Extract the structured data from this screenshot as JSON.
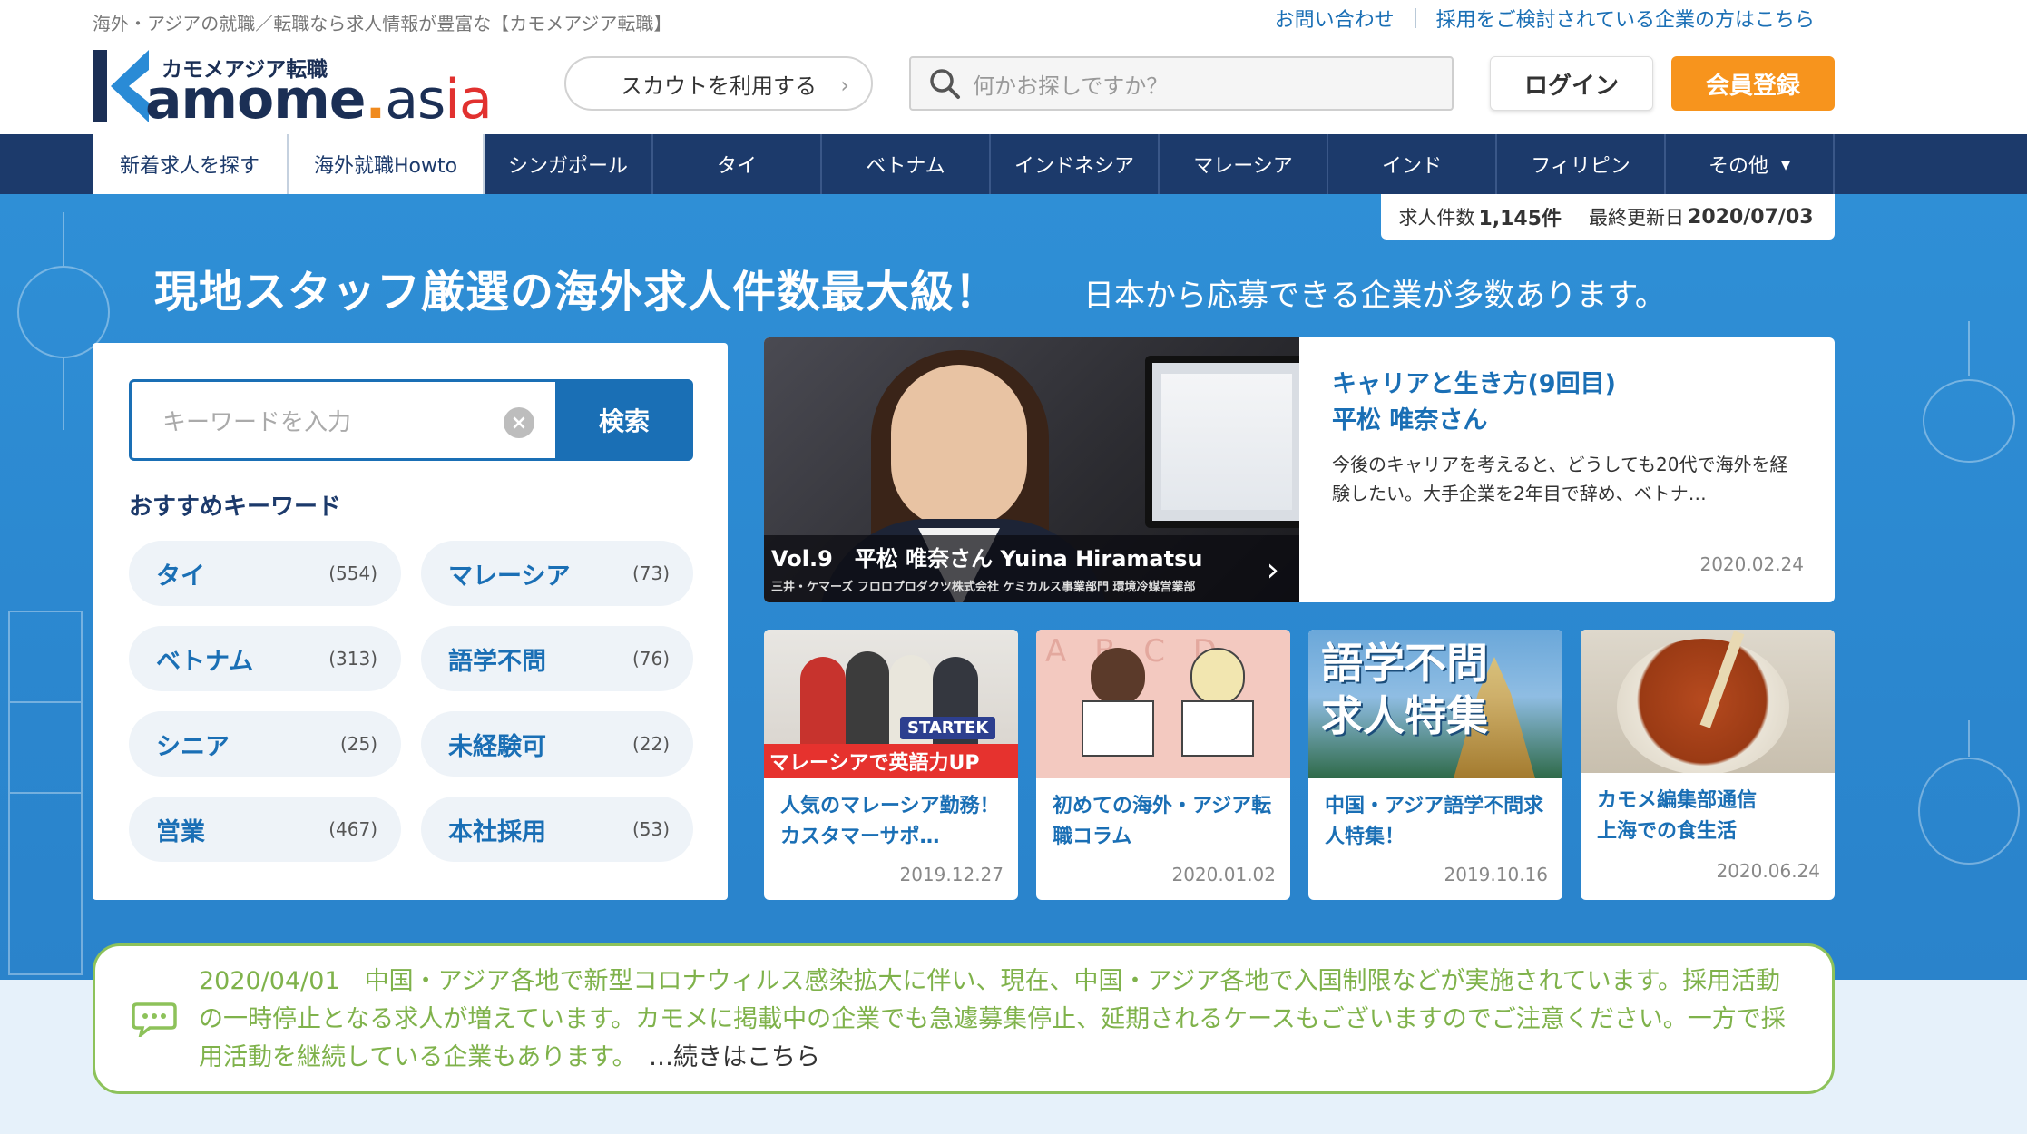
{
  "header": {
    "tagline": "海外・アジアの就職／転職なら求人情報が豊富な【カモメアジア転職】",
    "links": [
      "お問い合わせ",
      "採用をご検討されている企業の方はこちら"
    ],
    "logo_sub": "カモメアジア転職",
    "logo_word_main": "amome",
    "logo_word_dot": ".",
    "logo_word_as": "as",
    "logo_word_ia": "ia",
    "scout_label": "スカウトを利用する",
    "search_placeholder": "何かお探しですか？",
    "login_label": "ログイン",
    "signup_label": "会員登録",
    "colors": {
      "navy": "#1c3a6b",
      "accent_orange": "#f7941d",
      "link_blue": "#1a6fb5"
    }
  },
  "nav": {
    "items": [
      "新着求人を探す",
      "海外就職Howto",
      "シンガポール",
      "タイ",
      "ベトナム",
      "インドネシア",
      "マレーシア",
      "インド",
      "フィリピン",
      "その他"
    ]
  },
  "stats": {
    "jobs_label": "求人件数",
    "jobs_value": "1,145件",
    "updated_label": "最終更新日",
    "updated_value": "2020/07/03"
  },
  "hero": {
    "headline": "現地スタッフ厳選の海外求人件数最大級！",
    "subheadline": "日本から応募できる企業が多数あります。"
  },
  "search": {
    "placeholder": "キーワードを入力",
    "clear_glyph": "×",
    "button_label": "検索",
    "recommend_title": "おすすめキーワード",
    "keywords": [
      {
        "label": "タイ",
        "count": "(554)"
      },
      {
        "label": "マレーシア",
        "count": "(73)"
      },
      {
        "label": "ベトナム",
        "count": "(313)"
      },
      {
        "label": "語学不問",
        "count": "(76)"
      },
      {
        "label": "シニア",
        "count": "(25)"
      },
      {
        "label": "未経験可",
        "count": "(22)"
      },
      {
        "label": "営業",
        "count": "(467)"
      },
      {
        "label": "本社採用",
        "count": "(53)"
      }
    ]
  },
  "feature": {
    "caption_title": "Vol.9　平松 唯奈さん Yuina Hiramatsu",
    "caption_sub": "三井・ケマーズ フロロプロダクツ株式会社 ケミカルス事業部門 環境冷媒営業部",
    "title_line1": "キャリアと生き方(9回目)",
    "title_line2": "平松 唯奈さん",
    "desc": "今後のキャリアを考えると、どうしても20代で海外を経験したい。大手企業を2年目で辞め、ベトナ…",
    "date": "2020.02.24"
  },
  "cards": [
    {
      "title": "人気のマレーシア勤務！カスタマーサポ…",
      "date": "2019.12.27",
      "img_banner": "マレーシアで英語力UP",
      "img_logo": "STARTEK"
    },
    {
      "title": "初めての海外・アジア転職コラム",
      "date": "2020.01.02",
      "img_letters": "A B C D"
    },
    {
      "title": "中国・アジア語学不問求人特集！",
      "date": "2019.10.16",
      "img_text": "語学不問\n求人特集"
    },
    {
      "title": "カモメ編集部通信\n上海での食生活",
      "date": "2020.06.24"
    }
  ],
  "notice": {
    "text": "2020/04/01　中国・アジア各地で新型コロナウィルス感染拡大に伴い、現在、中国・アジア各地で入国制限などが実施されています。採用活動の一時停止となる求人が増えています。カモメに掲載中の企業でも急遽募集停止、延期されるケースもございますのでご注意ください。一方で採用活動を継続している企業もあります。",
    "more_label": "…続きはこちら",
    "accent_color": "#8dc25a"
  }
}
